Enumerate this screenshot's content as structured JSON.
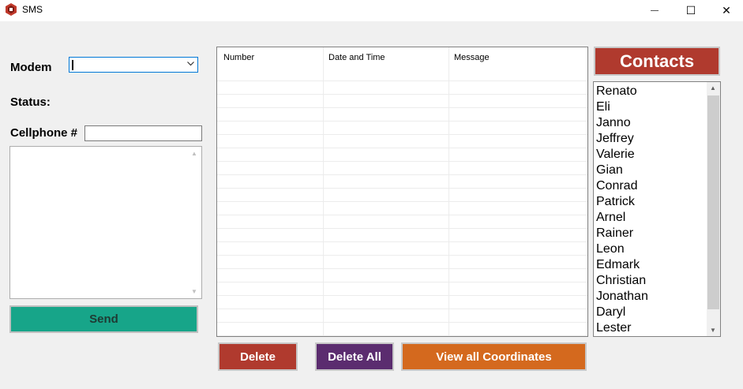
{
  "window": {
    "title": "SMS",
    "minimize_glyph": "—",
    "maximize_glyph": "☐",
    "close_glyph": "✕"
  },
  "form": {
    "modem_label": "Modem",
    "status_label": "Status:",
    "cellphone_label": "Cellphone #",
    "cellphone_value": "",
    "message_value": ""
  },
  "buttons": {
    "send": "Send",
    "delete": "Delete",
    "delete_all": "Delete All",
    "view_all": "View all Coordinates",
    "contacts": "Contacts"
  },
  "grid": {
    "columns": [
      "Number",
      "Date and Time",
      "Message"
    ]
  },
  "contacts": [
    "Renato",
    "Eli",
    "Janno",
    "Jeffrey",
    "Valerie",
    "Gian",
    "Conrad",
    "Patrick",
    "Arnel",
    "Rainer",
    "Leon",
    "Edmark",
    "Christian",
    "Jonathan",
    "Daryl",
    "Lester"
  ],
  "colors": {
    "send": "#17a589",
    "delete": "#b03a2e",
    "delete_all": "#5b2c6f",
    "view_all": "#d4691e",
    "contacts": "#b03a2e"
  },
  "icons": {
    "app": "sms-app-icon",
    "combo": "chevron-down-icon"
  }
}
